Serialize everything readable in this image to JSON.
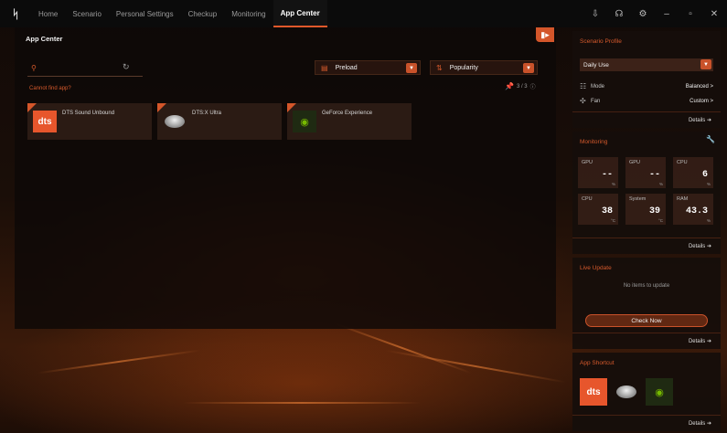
{
  "nav": {
    "tabs": [
      {
        "label": "Home"
      },
      {
        "label": "Scenario"
      },
      {
        "label": "Personal Settings"
      },
      {
        "label": "Checkup"
      },
      {
        "label": "Monitoring"
      },
      {
        "label": "App Center"
      }
    ],
    "active_tab": "App Center",
    "window_controls": [
      "download-icon",
      "headset-icon",
      "settings-icon",
      "minimize-icon",
      "maximize-icon",
      "close-icon"
    ]
  },
  "main": {
    "title": "App Center",
    "search": {
      "placeholder": "",
      "value": ""
    },
    "cant_find": "Cannot find app?",
    "filter_dropdown": {
      "value": "Preload"
    },
    "sort_dropdown": {
      "value": "Popularity"
    },
    "pinned_count": "3 / 3",
    "apps": [
      {
        "name": "DTS Sound Unbound",
        "icon": "dts-logo"
      },
      {
        "name": "DTS:X Ultra",
        "icon": "disc-logo"
      },
      {
        "name": "GeForce Experience",
        "icon": "nvidia-logo"
      }
    ]
  },
  "sidebar": {
    "scenario": {
      "title": "Scenario Profile",
      "profile": "Daily Use",
      "rows": [
        {
          "label": "Mode",
          "value": "Balanced >"
        },
        {
          "label": "Fan",
          "value": "Custom >"
        }
      ],
      "details": "Details"
    },
    "monitoring": {
      "title": "Monitoring",
      "tiles": [
        {
          "label": "GPU",
          "value": "--",
          "unit": "%"
        },
        {
          "label": "GPU",
          "value": "--",
          "unit": "%"
        },
        {
          "label": "CPU",
          "value": "6",
          "unit": "%"
        },
        {
          "label": "CPU",
          "value": "38",
          "unit": "°C"
        },
        {
          "label": "System",
          "value": "39",
          "unit": "°C"
        },
        {
          "label": "RAM",
          "value": "43.3",
          "unit": "%"
        }
      ],
      "details": "Details"
    },
    "live_update": {
      "title": "Live Update",
      "message": "No items to update",
      "button": "Check Now",
      "details": "Details"
    },
    "app_shortcut": {
      "title": "App Shortcut",
      "icons": [
        "dts-logo",
        "disc-logo",
        "nvidia-logo"
      ],
      "details": "Details"
    }
  },
  "colors": {
    "accent": "#d65a2c",
    "panel": "#16100c",
    "topbar": "#0b0b0b"
  }
}
